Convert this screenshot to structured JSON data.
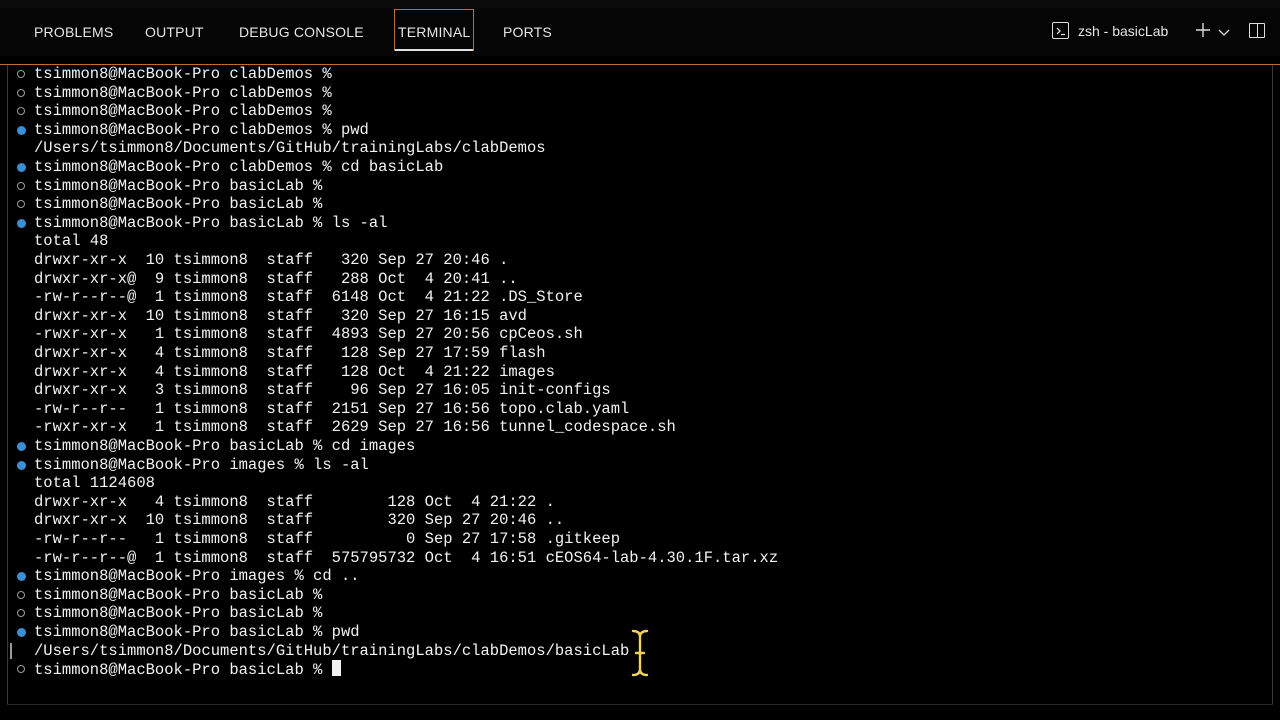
{
  "panel_tabs": [
    "PROBLEMS",
    "OUTPUT",
    "DEBUG CONSOLE",
    "TERMINAL",
    "PORTS"
  ],
  "active_tab": "TERMINAL",
  "terminal_instance": "zsh - basicLab",
  "icons": {
    "shell": "terminal-icon",
    "new": "plus-icon",
    "dropdown": "chevron-down-icon",
    "split": "split-terminal-icon",
    "cursor": "text-cursor-icon"
  },
  "colors": {
    "background": "#000000",
    "text": "#f2f2f2",
    "accent_border": "#b8703a",
    "run_marker": "#3b8fd6",
    "done_marker": "#9a9a9a"
  },
  "lines": [
    {
      "text": "tsimmon8@MacBook-Pro clabDemos %",
      "mark": "ok"
    },
    {
      "text": "tsimmon8@MacBook-Pro clabDemos %",
      "mark": "ok"
    },
    {
      "text": "tsimmon8@MacBook-Pro clabDemos %",
      "mark": "ok"
    },
    {
      "text": "tsimmon8@MacBook-Pro clabDemos % pwd",
      "mark": "run"
    },
    {
      "text": "/Users/tsimmon8/Documents/GitHub/trainingLabs/clabDemos",
      "mark": ""
    },
    {
      "text": "tsimmon8@MacBook-Pro clabDemos % cd basicLab",
      "mark": "run"
    },
    {
      "text": "tsimmon8@MacBook-Pro basicLab %",
      "mark": "ok"
    },
    {
      "text": "tsimmon8@MacBook-Pro basicLab %",
      "mark": "ok"
    },
    {
      "text": "tsimmon8@MacBook-Pro basicLab % ls -al",
      "mark": "run"
    },
    {
      "text": "total 48",
      "mark": ""
    },
    {
      "text": "drwxr-xr-x  10 tsimmon8  staff   320 Sep 27 20:46 .",
      "mark": ""
    },
    {
      "text": "drwxr-xr-x@  9 tsimmon8  staff   288 Oct  4 20:41 ..",
      "mark": ""
    },
    {
      "text": "-rw-r--r--@  1 tsimmon8  staff  6148 Oct  4 21:22 .DS_Store",
      "mark": ""
    },
    {
      "text": "drwxr-xr-x  10 tsimmon8  staff   320 Sep 27 16:15 avd",
      "mark": ""
    },
    {
      "text": "-rwxr-xr-x   1 tsimmon8  staff  4893 Sep 27 20:56 cpCeos.sh",
      "mark": ""
    },
    {
      "text": "drwxr-xr-x   4 tsimmon8  staff   128 Sep 27 17:59 flash",
      "mark": ""
    },
    {
      "text": "drwxr-xr-x   4 tsimmon8  staff   128 Oct  4 21:22 images",
      "mark": ""
    },
    {
      "text": "drwxr-xr-x   3 tsimmon8  staff    96 Sep 27 16:05 init-configs",
      "mark": ""
    },
    {
      "text": "-rw-r--r--   1 tsimmon8  staff  2151 Sep 27 16:56 topo.clab.yaml",
      "mark": ""
    },
    {
      "text": "-rwxr-xr-x   1 tsimmon8  staff  2629 Sep 27 16:56 tunnel_codespace.sh",
      "mark": ""
    },
    {
      "text": "tsimmon8@MacBook-Pro basicLab % cd images",
      "mark": "run"
    },
    {
      "text": "tsimmon8@MacBook-Pro images % ls -al",
      "mark": "run"
    },
    {
      "text": "total 1124608",
      "mark": ""
    },
    {
      "text": "drwxr-xr-x   4 tsimmon8  staff        128 Oct  4 21:22 .",
      "mark": ""
    },
    {
      "text": "drwxr-xr-x  10 tsimmon8  staff        320 Sep 27 20:46 ..",
      "mark": ""
    },
    {
      "text": "-rw-r--r--   1 tsimmon8  staff          0 Sep 27 17:58 .gitkeep",
      "mark": ""
    },
    {
      "text": "-rw-r--r--@  1 tsimmon8  staff  575795732 Oct  4 16:51 cEOS64-lab-4.30.1F.tar.xz",
      "mark": ""
    },
    {
      "text": "tsimmon8@MacBook-Pro images % cd ..",
      "mark": "run"
    },
    {
      "text": "tsimmon8@MacBook-Pro basicLab %",
      "mark": "ok"
    },
    {
      "text": "tsimmon8@MacBook-Pro basicLab %",
      "mark": "ok"
    },
    {
      "text": "tsimmon8@MacBook-Pro basicLab % pwd",
      "mark": "run"
    },
    {
      "text": "/Users/tsimmon8/Documents/GitHub/trainingLabs/clabDemos/basicLab",
      "mark": ""
    },
    {
      "text": "tsimmon8@MacBook-Pro basicLab % ",
      "mark": "ok"
    }
  ]
}
